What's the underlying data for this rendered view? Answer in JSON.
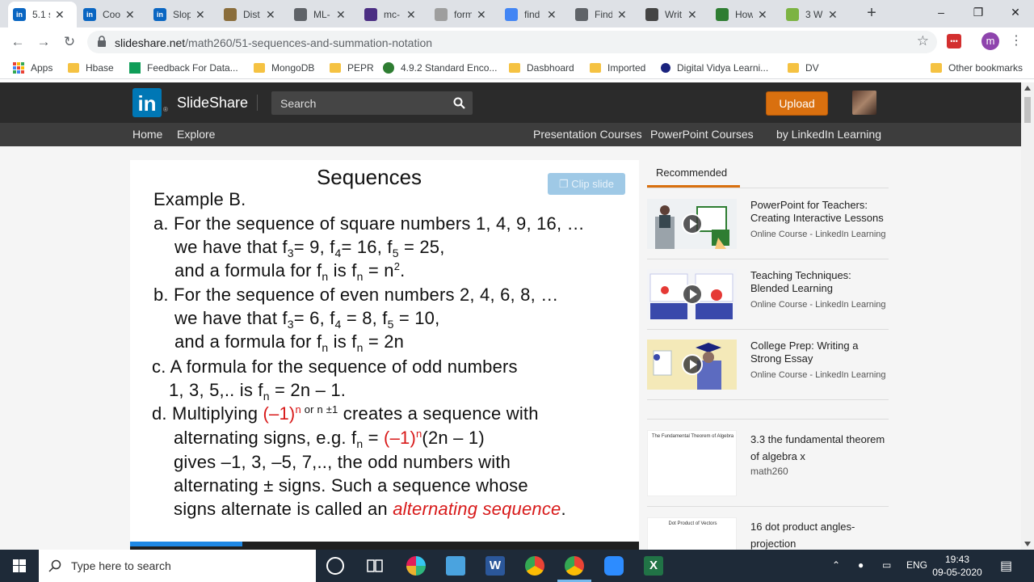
{
  "browser": {
    "tabs": [
      {
        "title": "5.1 s",
        "favicon": "linkedin-icon",
        "color": "#0a66c2",
        "active": true
      },
      {
        "title": "Coo",
        "favicon": "linkedin-icon",
        "color": "#0a66c2"
      },
      {
        "title": "Slop",
        "favicon": "linkedin-icon",
        "color": "#0a66c2"
      },
      {
        "title": "Dist",
        "favicon": "doc-icon",
        "color": "#8a6d3b"
      },
      {
        "title": "ML-",
        "favicon": "globe-icon",
        "color": "#5f6368"
      },
      {
        "title": "mc-",
        "favicon": "shield-icon",
        "color": "#4b2e83"
      },
      {
        "title": "form",
        "favicon": "page-icon",
        "color": "#9e9e9e"
      },
      {
        "title": "find",
        "favicon": "google-icon",
        "color": "#4285f4"
      },
      {
        "title": "Find",
        "favicon": "globe-icon",
        "color": "#5f6368"
      },
      {
        "title": "Writ",
        "favicon": "pen-icon",
        "color": "#444"
      },
      {
        "title": "How",
        "favicon": "power-icon",
        "color": "#2e7d32"
      },
      {
        "title": "3 W",
        "favicon": "circle-icon",
        "color": "#7cb342"
      }
    ],
    "url_host": "slideshare.net",
    "url_path": "/math260/51-sequences-and-summation-notation",
    "profile_initial": "m",
    "bookmarks": [
      {
        "label": "Apps",
        "icon": "apps-grid-icon"
      },
      {
        "label": "Hbase",
        "icon": "folder-icon"
      },
      {
        "label": "Feedback For Data...",
        "icon": "plus-doc-icon"
      },
      {
        "label": "MongoDB",
        "icon": "folder-icon"
      },
      {
        "label": "PEPR",
        "icon": "folder-icon"
      },
      {
        "label": "4.9.2 Standard Enco...",
        "icon": "bug-icon"
      },
      {
        "label": "Dasbhoard",
        "icon": "folder-icon"
      },
      {
        "label": "Imported",
        "icon": "folder-icon"
      },
      {
        "label": "Digital Vidya Learni...",
        "icon": "dv-icon"
      },
      {
        "label": "DV",
        "icon": "folder-icon"
      },
      {
        "label": "Other bookmarks",
        "icon": "folder-icon"
      }
    ]
  },
  "slideshare": {
    "brand": "SlideShare",
    "logo_text": "in",
    "search_placeholder": "Search",
    "upload_label": "Upload",
    "nav_left": [
      "Home",
      "Explore"
    ],
    "nav_right": [
      "Presentation Courses",
      "PowerPoint Courses",
      "by LinkedIn Learning"
    ]
  },
  "slide": {
    "title": "Sequences",
    "clip_label": "Clip slide",
    "line1": "Example B.",
    "a1": "a. For the sequence of square numbers 1, 4, 9, 16, …",
    "a2_pre": "we have that f",
    "a2_s1": "3",
    "a2_m1": "= 9, f",
    "a2_s2": "4",
    "a2_m2": "= 16, f",
    "a2_s3": "5",
    "a2_end": " = 25,",
    "a3_pre": "and a formula for f",
    "a3_s1": "n",
    "a3_mid": " is f",
    "a3_s2": "n",
    "a3_end": " = n",
    "a3_sup": "2",
    "a3_dot": ".",
    "b1": "b. For the sequence of even numbers 2, 4, 6, 8, …",
    "b2_pre": "we have that f",
    "b2_s1": "3",
    "b2_m1": "= 6, f",
    "b2_s2": "4",
    "b2_m2": " = 8, f",
    "b2_s3": "5",
    "b2_end": " = 10,",
    "b3_pre": "and a formula for f",
    "b3_s1": "n",
    "b3_mid": " is f",
    "b3_s2": "n",
    "b3_end": " = 2n",
    "c1": "c. A formula for the sequence of odd numbers",
    "c2_pre": "1, 3, 5,.. is f",
    "c2_s": "n",
    "c2_end": " = 2n – 1.",
    "d1_pre": "d. Multiplying ",
    "d1_red": "(–1)",
    "d1_sup": "n",
    "d1_small": " or n ±1",
    "d1_end": " creates a sequence with",
    "d2_pre": "alternating signs, e.g. f",
    "d2_s": "n",
    "d2_eq": " = ",
    "d2_red": "(–1)",
    "d2_sup": "n",
    "d2_end": "(2n – 1)",
    "d3": "gives –1, 3, –5, 7,.., the odd numbers with",
    "d4_pre": "alternating ",
    "d4_pm": "±",
    "d4_end": " signs. Such a sequence whose",
    "d5_pre": "signs alternate is called an ",
    "d5_italic": "alternating sequence",
    "d5_end": ".",
    "progress": 0.22
  },
  "recommended": {
    "tab_label": "Recommended",
    "items": [
      {
        "title": "PowerPoint for Teachers: Creating Interactive Lessons",
        "meta": "Online Course - LinkedIn Learning"
      },
      {
        "title": "Teaching Techniques: Blended Learning",
        "meta": "Online Course - LinkedIn Learning"
      },
      {
        "title": "College Prep: Writing a Strong Essay",
        "meta": "Online Course - LinkedIn Learning"
      },
      {
        "title": "3.3 the fundamental theorem of algebra x",
        "meta": "math260",
        "thumb_text": "The Fundamental Theorem of Algebra"
      },
      {
        "title": "16 dot product angles-projection",
        "meta": "",
        "thumb_text": "Dot Product of Vectors"
      }
    ]
  },
  "taskbar": {
    "search_placeholder": "Type here to search",
    "lang": "ENG",
    "time": "19:43",
    "date": "09-05-2020"
  }
}
